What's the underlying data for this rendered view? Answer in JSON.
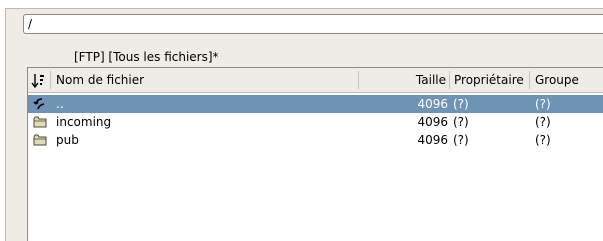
{
  "path_bar": {
    "value": "/"
  },
  "location_label": "[FTP] [Tous les fichiers]*",
  "table": {
    "columns": {
      "sort_icon": "sort-descending-icon",
      "name": "Nom de fichier",
      "size": "Taille",
      "owner": "Propriétaire",
      "group": "Groupe"
    },
    "rows": [
      {
        "icon": "parent-directory-icon",
        "name": "..",
        "size": "4096",
        "owner": "(?)",
        "group": "(?)",
        "selected": true
      },
      {
        "icon": "folder-icon",
        "name": "incoming",
        "size": "4096",
        "owner": "(?)",
        "group": "(?)",
        "selected": false
      },
      {
        "icon": "folder-icon",
        "name": "pub",
        "size": "4096",
        "owner": "(?)",
        "group": "(?)",
        "selected": false
      }
    ]
  },
  "colors": {
    "selection": "#6f93b5",
    "background": "#efebe7"
  }
}
